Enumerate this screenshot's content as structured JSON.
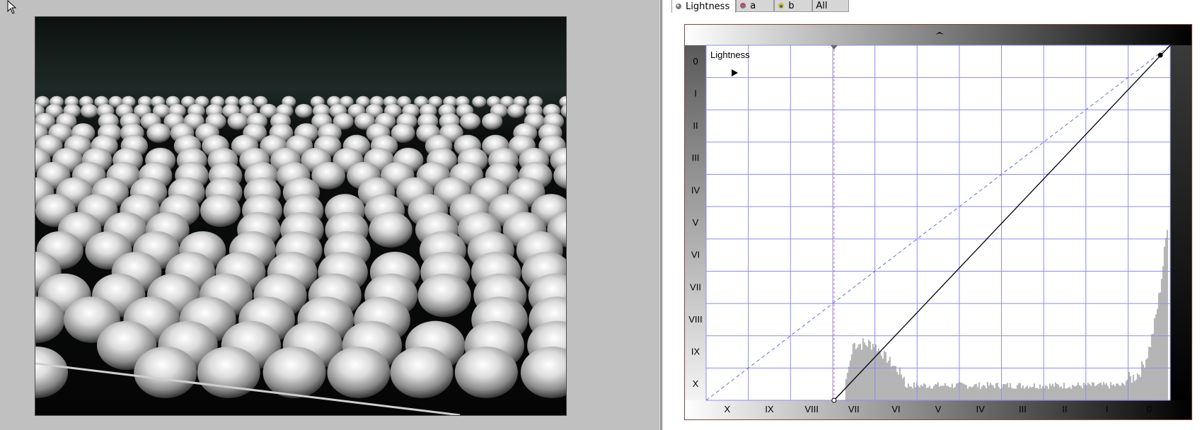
{
  "tabs": [
    {
      "label": "Lightness",
      "icon": "radio-dot-icon",
      "active": true
    },
    {
      "label": "a",
      "icon": "a-channel-icon",
      "active": false
    },
    {
      "label": "b",
      "icon": "b-channel-icon",
      "active": false
    },
    {
      "label": "All",
      "icon": "",
      "active": false
    }
  ],
  "curves": {
    "channel_label": "Lightness",
    "zone_labels_y": [
      "0",
      "I",
      "II",
      "III",
      "IV",
      "V",
      "VI",
      "VII",
      "VIII",
      "IX",
      "X"
    ],
    "zone_labels_x": [
      "X",
      "IX",
      "VIII",
      "VII",
      "VI",
      "V",
      "IV",
      "III",
      "II",
      "I",
      "0"
    ],
    "curve_points": [
      [
        0.2756,
        0.0
      ],
      [
        1.0,
        1.0
      ]
    ],
    "black_point_marker": 0.2756,
    "colors": {
      "grid": "#8c8cf0",
      "curve": "#000000",
      "reference_line": "#6a6ae0",
      "histogram": "#b0b0b0",
      "marker_line": "#e06a6a",
      "panel_border": "#8a4040"
    }
  },
  "photo": {
    "description_icon": "mirror-spheres-photo"
  }
}
